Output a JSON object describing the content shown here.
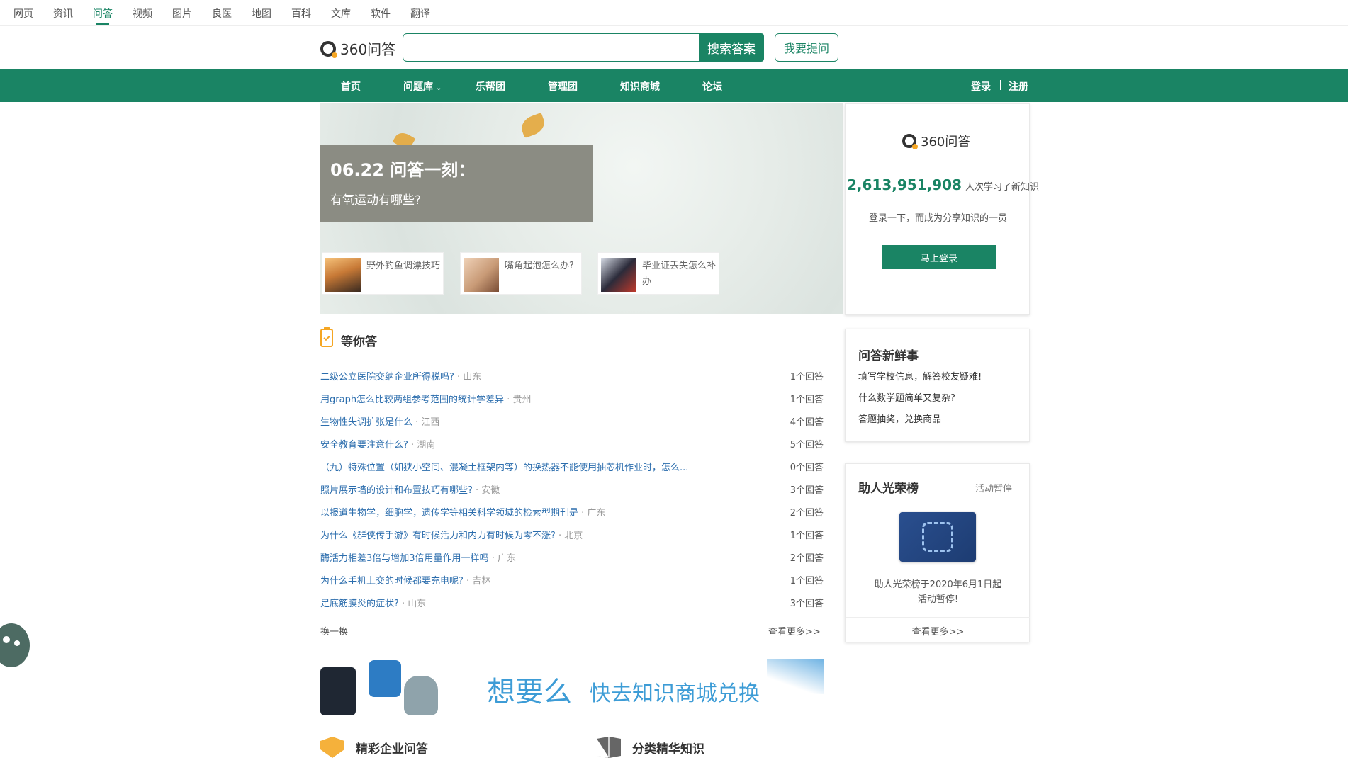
{
  "top_nav": [
    "网页",
    "资讯",
    "问答",
    "视频",
    "图片",
    "良医",
    "地图",
    "百科",
    "文库",
    "软件",
    "翻译"
  ],
  "top_nav_active": "问答",
  "logo_text": "360问答",
  "search": {
    "placeholder": "",
    "button": "搜索答案",
    "ask": "我要提问"
  },
  "main_nav": {
    "home": "首页",
    "library": "问题库",
    "lebang": "乐帮团",
    "admin": "管理团",
    "store": "知识商城",
    "forum": "论坛",
    "login": "登录",
    "register": "注册"
  },
  "banner": {
    "date_title": "06.22 问答一刻：",
    "question": "有氧运动有哪些?",
    "thumbs": [
      "野外钓鱼调漂技巧",
      "嘴角起泡怎么办?",
      "毕业证丢失怎么补办"
    ]
  },
  "login_card": {
    "number": "2,613,951,908",
    "number_suffix": "人次学习了新知识",
    "invite": "登录一下，而成为分享知识的一员",
    "button": "马上登录"
  },
  "waiting": {
    "title": "等你答",
    "questions": [
      {
        "q": "二级公立医院交纳企业所得税吗?",
        "loc": "· 山东",
        "ans": "1个回答"
      },
      {
        "q": "用graph怎么比较两组参考范围的统计学差异",
        "loc": "· 贵州",
        "ans": "1个回答"
      },
      {
        "q": "生物性失调扩张是什么",
        "loc": "· 江西",
        "ans": "4个回答"
      },
      {
        "q": "安全教育要注意什么?",
        "loc": "· 湖南",
        "ans": "5个回答"
      },
      {
        "q": "（九）特殊位置（如狭小空间、混凝土框架内等）的换热器不能使用抽芯机作业时，怎么...",
        "loc": "",
        "ans": "0个回答"
      },
      {
        "q": "照片展示墙的设计和布置技巧有哪些?",
        "loc": "· 安徽",
        "ans": "3个回答"
      },
      {
        "q": "以报道生物学，细胞学，遗传学等相关科学领域的检索型期刊是",
        "loc": "· 广东",
        "ans": "2个回答"
      },
      {
        "q": "为什么《群侠传手游》有时候活力和内力有时候为零不涨?",
        "loc": "· 北京",
        "ans": "1个回答"
      },
      {
        "q": "酶活力相差3倍与增加3倍用量作用一样吗",
        "loc": "· 广东",
        "ans": "2个回答"
      },
      {
        "q": "为什么手机上交的时候都要充电呢?",
        "loc": "· 吉林",
        "ans": "1个回答"
      },
      {
        "q": "足底筋膜炎的症状?",
        "loc": "· 山东",
        "ans": "3个回答"
      }
    ],
    "refresh": "换一换",
    "more": "查看更多>>"
  },
  "news_card": {
    "title": "问答新鲜事",
    "items": [
      "填写学校信息，解答校友疑难!",
      "什么数学题简单又复杂?",
      "答题抽奖，兑换商品"
    ]
  },
  "honor_card": {
    "title": "助人光荣榜",
    "status": "活动暂停",
    "note_line1": "助人光荣榜于2020年6月1日起",
    "note_line2": "活动暂停!",
    "more": "查看更多>>"
  },
  "promo": {
    "big": "想要么",
    "small": "快去知识商城兑换"
  },
  "bottom": {
    "enterprise": "精彩企业问答",
    "category": "分类精华知识"
  },
  "colors": {
    "brand_green": "#1a8464",
    "link_blue": "#2b6dad",
    "accent_orange": "#f5a623"
  }
}
